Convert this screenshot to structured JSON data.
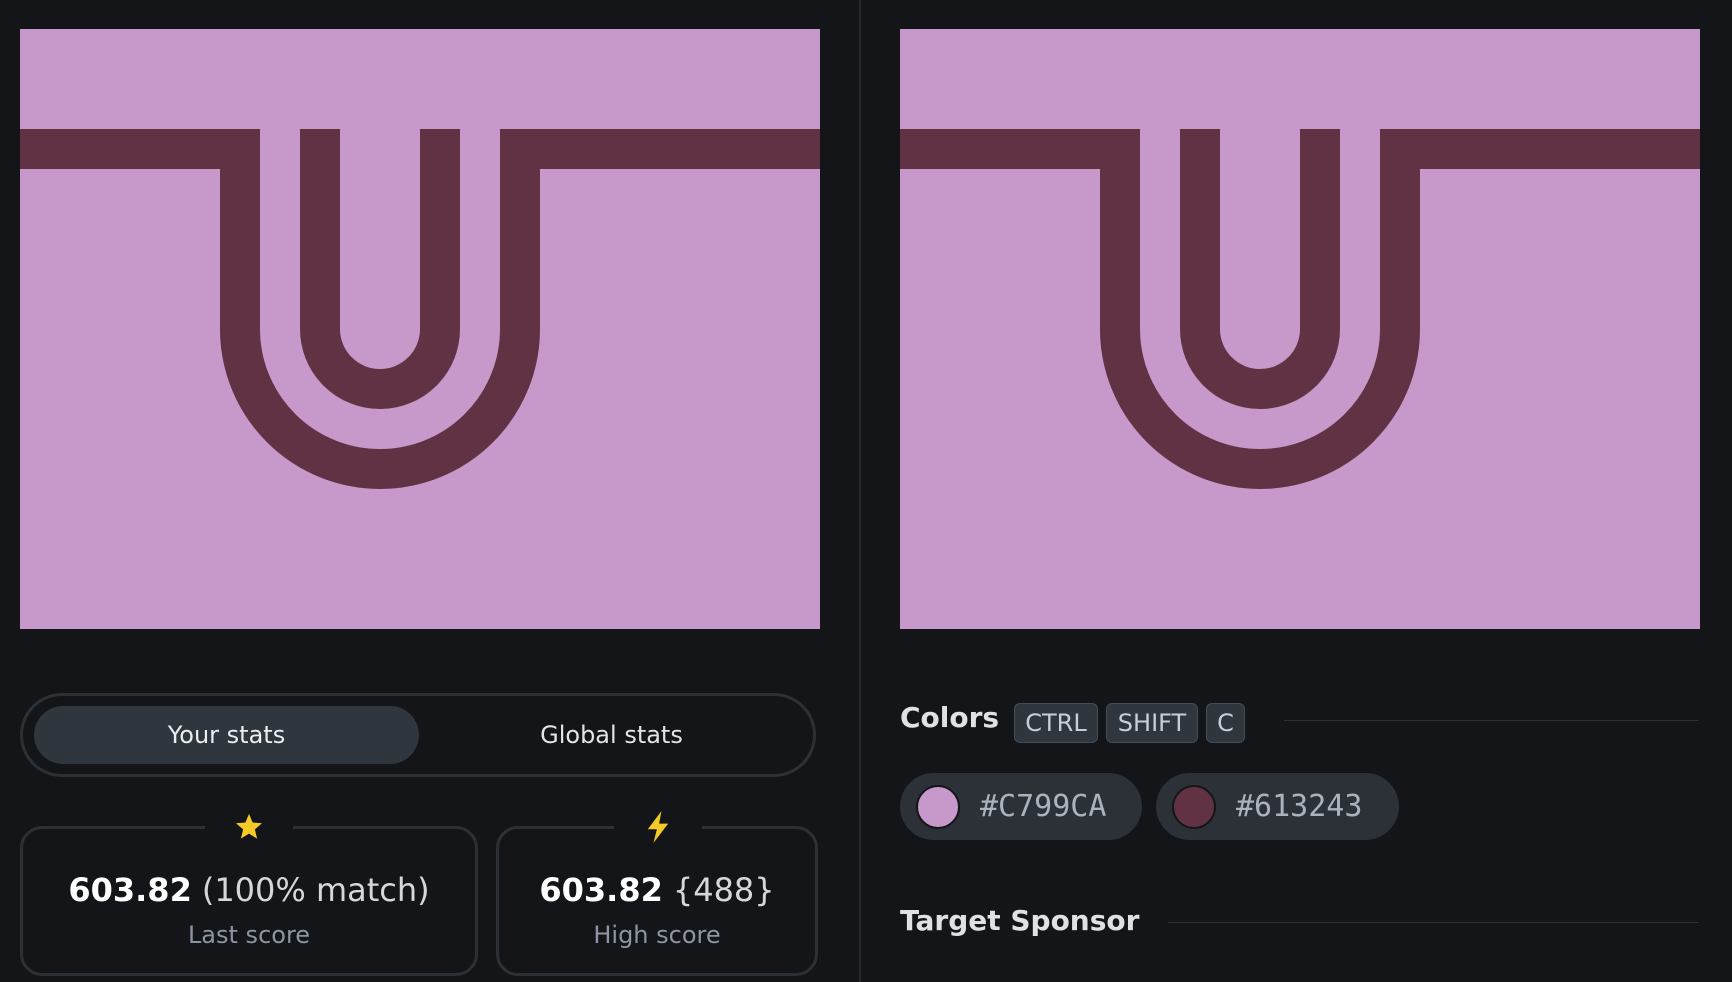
{
  "colors": {
    "background": "#C799CA",
    "stroke": "#613243",
    "swatches": [
      {
        "hex": "#C799CA",
        "color": "#C799CA"
      },
      {
        "hex": "#613243",
        "color": "#613243"
      }
    ]
  },
  "stats_tabs": {
    "your_stats": "Your stats",
    "global_stats": "Global stats",
    "active": "your_stats"
  },
  "last_score": {
    "value": "603.82",
    "extra": "(100% match)",
    "label": "Last score",
    "icon": "star-icon"
  },
  "high_score": {
    "value": "603.82",
    "extra": "{488}",
    "label": "High score",
    "icon": "lightning-icon"
  },
  "colors_section": {
    "title": "Colors",
    "shortcut_keys": [
      "CTRL",
      "SHIFT",
      "C"
    ]
  },
  "sponsor_section": {
    "title": "Target Sponsor"
  }
}
